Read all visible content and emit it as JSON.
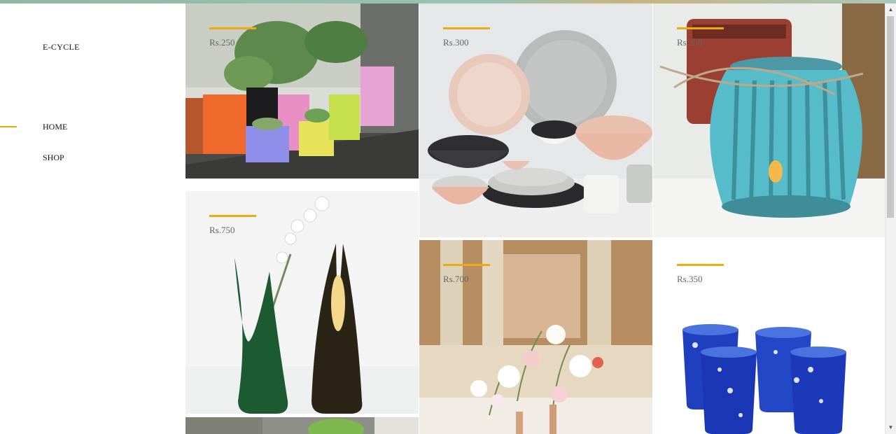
{
  "sidebar": {
    "brand": "E-CYCLE",
    "nav": [
      {
        "label": "HOME",
        "active": true
      },
      {
        "label": "SHOP",
        "active": false
      }
    ]
  },
  "products": [
    {
      "price": "Rs.250"
    },
    {
      "price": "Rs.300"
    },
    {
      "price": "Rs.350"
    },
    {
      "price": "Rs.750"
    },
    {
      "price": "Rs.700"
    },
    {
      "price": "Rs.350"
    }
  ],
  "colors": {
    "accent": "#e9ad10",
    "price_text": "#666666",
    "nav_text": "#111111"
  }
}
